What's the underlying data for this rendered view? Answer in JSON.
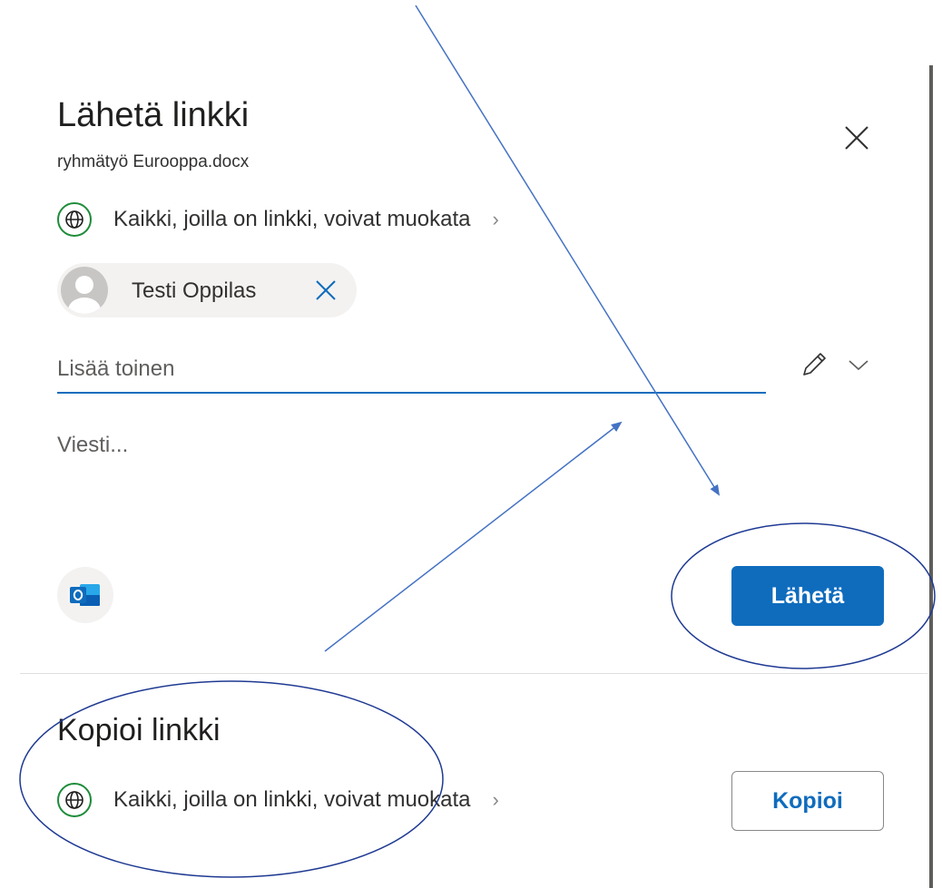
{
  "dialog": {
    "title": "Lähetä linkki",
    "filename": "ryhmätyö Eurooppa.docx",
    "permission": "Kaikki, joilla on linkki, voivat muokata",
    "recipient": {
      "name": "Testi Oppilas"
    },
    "add_placeholder": "Lisää toinen",
    "message_placeholder": "Viesti...",
    "send_label": "Lähetä"
  },
  "copy_section": {
    "title": "Kopioi linkki",
    "permission": "Kaikki, joilla on linkki, voivat muokata",
    "copy_label": "Kopioi"
  },
  "icons": {
    "close": "close-icon",
    "permission": "globe-icon",
    "remove": "remove-recipient-icon",
    "edit": "pencil-icon",
    "dropdown": "chevron-down-icon",
    "mail_app": "outlook-icon"
  },
  "colors": {
    "accent": "#0f6cbd",
    "globe": "#1e8c3a",
    "annotation": "#1f3a93"
  }
}
